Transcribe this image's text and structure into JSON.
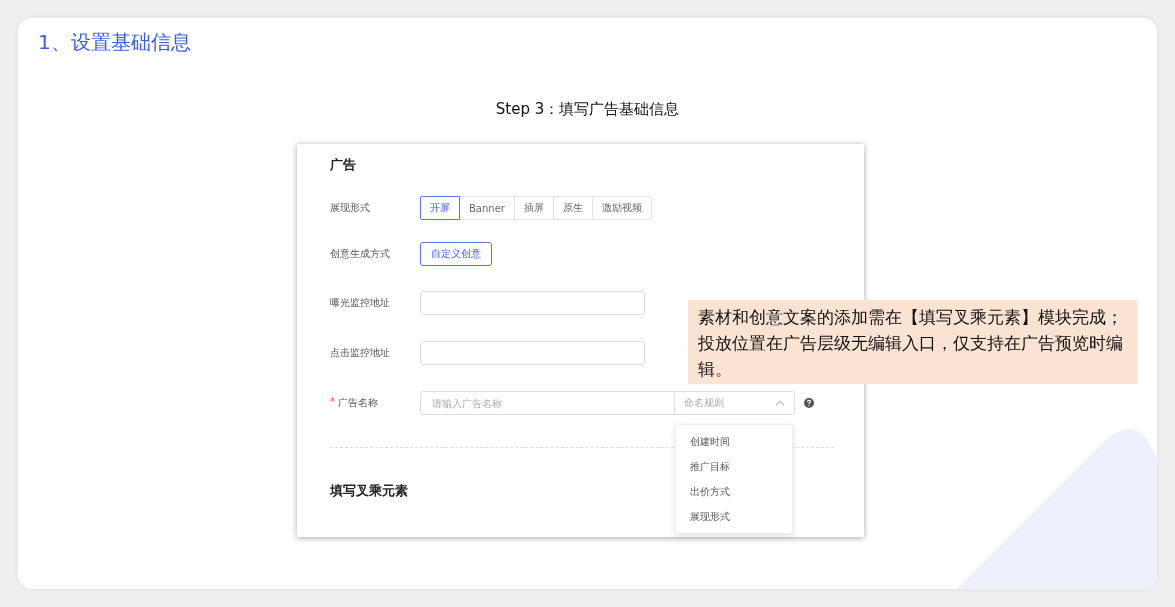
{
  "heading": {
    "title": "1、设置基础信息"
  },
  "step_caption": "Step 3：填写广告基础信息",
  "form": {
    "section_title": "广告",
    "fields": [
      {
        "kind": "segmented",
        "label": "展现形式",
        "options": [
          {
            "label": "开屏",
            "selected": true
          },
          {
            "label": "Banner",
            "selected": false
          },
          {
            "label": "插屏",
            "selected": false
          },
          {
            "label": "原生",
            "selected": false
          },
          {
            "label": "激励视频",
            "selected": false
          }
        ]
      },
      {
        "kind": "button",
        "label": "创意生成方式",
        "button": "自定义创意"
      },
      {
        "kind": "text",
        "label": "曝光监控地址"
      },
      {
        "kind": "text",
        "label": "点击监控地址"
      },
      {
        "kind": "name",
        "label": "广告名称",
        "required_mark": "*",
        "placeholder": "请输入广告名称",
        "select": {
          "placeholder": "命名规则",
          "expanded": true,
          "options": [
            "创建时间",
            "推广目标",
            "出价方式",
            "展现形式"
          ]
        }
      }
    ],
    "next_section_title": "填写叉乘元素"
  },
  "note": "素材和创意文案的添加需在【填写叉乘元素】模块完成；投放位置在广告层级无编辑入口，仅支持在广告预览时编辑。"
}
